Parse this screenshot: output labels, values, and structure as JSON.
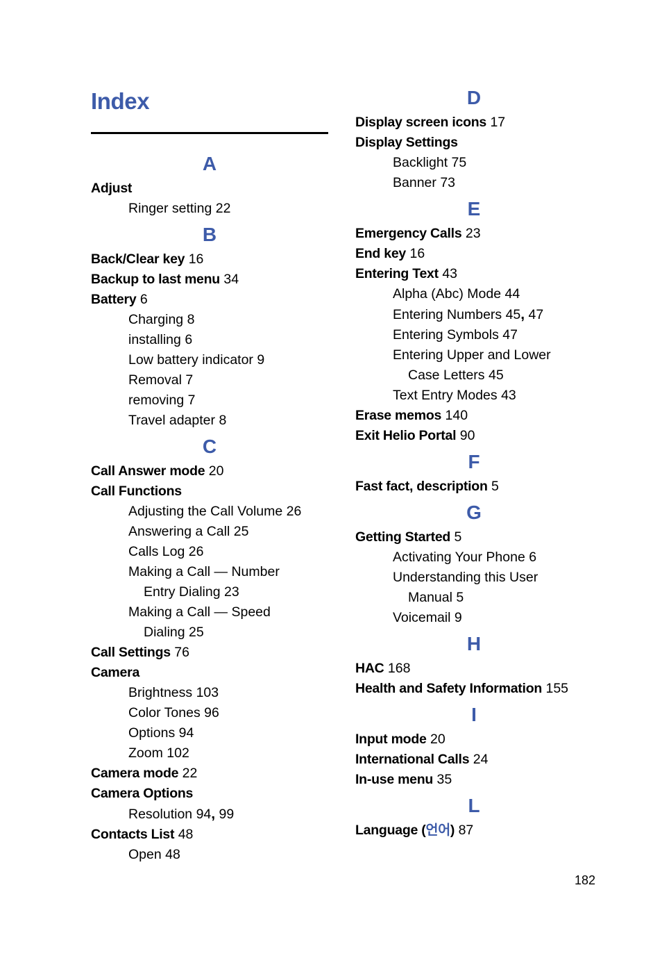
{
  "document": {
    "title": "Index",
    "page_number": "182",
    "accent_color": "#3d5ba9",
    "rule_color": "#000000"
  },
  "columns": [
    {
      "name": "left-column",
      "blocks": [
        {
          "type": "letter",
          "label": "A"
        },
        {
          "type": "entry",
          "level": 0,
          "term": "Adjust",
          "page": ""
        },
        {
          "type": "entry",
          "level": 1,
          "term": "Ringer setting",
          "page": "22"
        },
        {
          "type": "letter",
          "label": "B"
        },
        {
          "type": "entry",
          "level": 0,
          "term": "Back/Clear key",
          "page": "16"
        },
        {
          "type": "entry",
          "level": 0,
          "term": "Backup to last menu",
          "page": "34"
        },
        {
          "type": "entry",
          "level": 0,
          "term": "Battery",
          "page": "6"
        },
        {
          "type": "entry",
          "level": 1,
          "term": "Charging",
          "page": "8"
        },
        {
          "type": "entry",
          "level": 1,
          "term": "installing",
          "page": "6"
        },
        {
          "type": "entry",
          "level": 1,
          "term": "Low battery indicator",
          "page": "9"
        },
        {
          "type": "entry",
          "level": 1,
          "term": "Removal",
          "page": "7"
        },
        {
          "type": "entry",
          "level": 1,
          "term": "removing",
          "page": "7"
        },
        {
          "type": "entry",
          "level": 1,
          "term": "Travel adapter",
          "page": "8"
        },
        {
          "type": "letter",
          "label": "C"
        },
        {
          "type": "entry",
          "level": 0,
          "term": "Call Answer mode",
          "page": "20"
        },
        {
          "type": "entry",
          "level": 0,
          "term": "Call Functions",
          "page": ""
        },
        {
          "type": "entry",
          "level": 1,
          "term": "Adjusting the Call Volume",
          "page": "26"
        },
        {
          "type": "entry",
          "level": 1,
          "term": "Answering a Call",
          "page": "25"
        },
        {
          "type": "entry",
          "level": 1,
          "term": "Calls Log",
          "page": "26"
        },
        {
          "type": "entry",
          "level": 1,
          "term": "Making a Call — Number",
          "page": ""
        },
        {
          "type": "entry",
          "level": 2,
          "term": "Entry Dialing",
          "page": "23"
        },
        {
          "type": "entry",
          "level": 1,
          "term": "Making a Call — Speed",
          "page": ""
        },
        {
          "type": "entry",
          "level": 2,
          "term": "Dialing",
          "page": "25"
        },
        {
          "type": "entry",
          "level": 0,
          "term": "Call Settings",
          "page": "76"
        },
        {
          "type": "entry",
          "level": 0,
          "term": "Camera",
          "page": ""
        },
        {
          "type": "entry",
          "level": 1,
          "term": "Brightness",
          "page": "103"
        },
        {
          "type": "entry",
          "level": 1,
          "term": "Color Tones",
          "page": "96"
        },
        {
          "type": "entry",
          "level": 1,
          "term": "Options",
          "page": "94"
        },
        {
          "type": "entry",
          "level": 1,
          "term": "Zoom",
          "page": "102"
        },
        {
          "type": "entry",
          "level": 0,
          "term": "Camera mode",
          "page": "22"
        },
        {
          "type": "entry",
          "level": 0,
          "term": "Camera Options",
          "page": ""
        },
        {
          "type": "entry",
          "level": 1,
          "term": "Resolution",
          "page": "94, 99"
        },
        {
          "type": "entry",
          "level": 0,
          "term": "Contacts List",
          "page": "48"
        },
        {
          "type": "entry",
          "level": 1,
          "term": "Open",
          "page": "48"
        }
      ]
    },
    {
      "name": "right-column",
      "blocks": [
        {
          "type": "letter",
          "label": "D"
        },
        {
          "type": "entry",
          "level": 0,
          "term": "Display screen icons",
          "page": "17"
        },
        {
          "type": "entry",
          "level": 0,
          "term": "Display Settings",
          "page": ""
        },
        {
          "type": "entry",
          "level": 1,
          "term": "Backlight",
          "page": "75"
        },
        {
          "type": "entry",
          "level": 1,
          "term": "Banner",
          "page": "73"
        },
        {
          "type": "letter",
          "label": "E"
        },
        {
          "type": "entry",
          "level": 0,
          "term": "Emergency Calls",
          "page": "23"
        },
        {
          "type": "entry",
          "level": 0,
          "term": "End key",
          "page": "16"
        },
        {
          "type": "entry",
          "level": 0,
          "term": "Entering Text",
          "page": "43"
        },
        {
          "type": "entry",
          "level": 1,
          "term": "Alpha (Abc) Mode",
          "page": "44"
        },
        {
          "type": "entry",
          "level": 1,
          "term": "Entering Numbers",
          "page": "45, 47"
        },
        {
          "type": "entry",
          "level": 1,
          "term": "Entering Symbols",
          "page": "47"
        },
        {
          "type": "entry",
          "level": 1,
          "term": "Entering Upper and Lower",
          "page": ""
        },
        {
          "type": "entry",
          "level": 2,
          "term": "Case Letters",
          "page": "45"
        },
        {
          "type": "entry",
          "level": 1,
          "term": "Text Entry Modes",
          "page": "43"
        },
        {
          "type": "entry",
          "level": 0,
          "term": "Erase memos",
          "page": "140"
        },
        {
          "type": "entry",
          "level": 0,
          "term": "Exit Helio Portal",
          "page": "90"
        },
        {
          "type": "letter",
          "label": "F"
        },
        {
          "type": "entry",
          "level": 0,
          "term": "Fast fact, description",
          "page": "5"
        },
        {
          "type": "letter",
          "label": "G"
        },
        {
          "type": "entry",
          "level": 0,
          "term": "Getting Started",
          "page": "5"
        },
        {
          "type": "entry",
          "level": 1,
          "term": "Activating Your Phone",
          "page": "6"
        },
        {
          "type": "entry",
          "level": 1,
          "term": "Understanding this User",
          "page": ""
        },
        {
          "type": "entry",
          "level": 2,
          "term": "Manual",
          "page": "5"
        },
        {
          "type": "entry",
          "level": 1,
          "term": "Voicemail",
          "page": "9"
        },
        {
          "type": "letter",
          "label": "H"
        },
        {
          "type": "entry",
          "level": 0,
          "term": "HAC",
          "page": "168"
        },
        {
          "type": "entry",
          "level": 0,
          "term": "Health and Safety Information",
          "page": "155"
        },
        {
          "type": "letter",
          "label": "I"
        },
        {
          "type": "entry",
          "level": 0,
          "term": "Input mode",
          "page": "20"
        },
        {
          "type": "entry",
          "level": 0,
          "term": "International Calls",
          "page": "24"
        },
        {
          "type": "entry",
          "level": 0,
          "term": "In-use menu",
          "page": "35"
        },
        {
          "type": "letter",
          "label": "L"
        },
        {
          "type": "entry",
          "level": 0,
          "term": "Language (언어)",
          "page": "87",
          "korean": "언어"
        }
      ]
    }
  ]
}
